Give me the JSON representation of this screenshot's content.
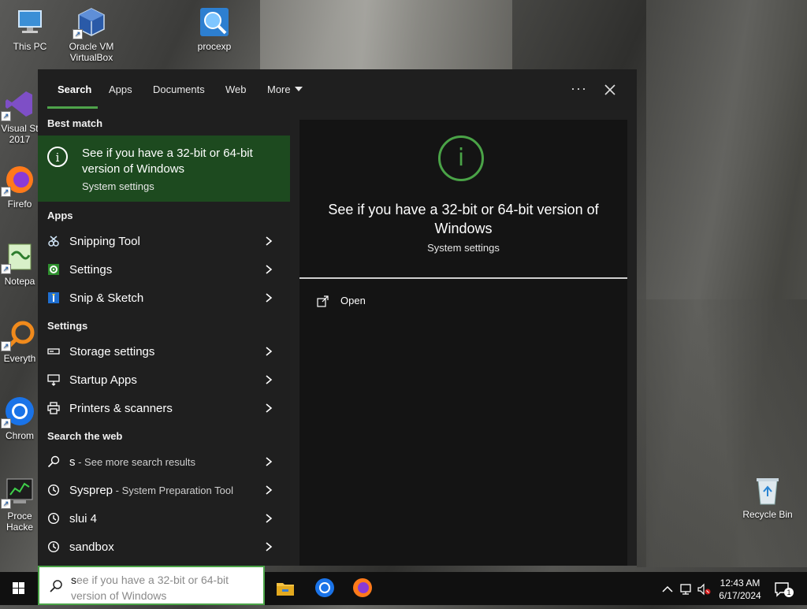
{
  "desktop": {
    "icons": [
      {
        "label": "This PC"
      },
      {
        "label": "Oracle VM VirtualBox"
      },
      {
        "label": "procexp"
      },
      {
        "label": "Visual St 2017"
      },
      {
        "label": "Firefo"
      },
      {
        "label": "Notepa"
      },
      {
        "label": "Everyth"
      },
      {
        "label": "Chrom"
      },
      {
        "label": "Proce Hacke"
      },
      {
        "label": "Recycle Bin"
      }
    ]
  },
  "search": {
    "tabs": [
      "Search",
      "Apps",
      "Documents",
      "Web",
      "More"
    ],
    "best_match": {
      "heading": "Best match",
      "title": "See if you have a 32-bit or 64-bit version of Windows",
      "subtitle": "System settings"
    },
    "apps_heading": "Apps",
    "apps": [
      {
        "label": "Snipping Tool",
        "icon": "snipping-tool-icon"
      },
      {
        "label": "Settings",
        "icon": "gear-icon"
      },
      {
        "label": "Snip & Sketch",
        "icon": "snip-sketch-icon"
      }
    ],
    "settings_heading": "Settings",
    "settings": [
      {
        "label": "Storage settings",
        "icon": "storage-icon"
      },
      {
        "label": "Startup Apps",
        "icon": "startup-icon"
      },
      {
        "label": "Printers & scanners",
        "icon": "printer-icon"
      }
    ],
    "web_heading": "Search the web",
    "web": [
      {
        "label": "s",
        "detail": " - See more search results",
        "icon": "search-icon"
      },
      {
        "label": "Sysprep",
        "detail": " - System Preparation Tool",
        "icon": "history-icon"
      },
      {
        "label": "slui 4",
        "detail": "",
        "icon": "history-icon"
      },
      {
        "label": "sandbox",
        "detail": "",
        "icon": "history-icon"
      }
    ],
    "preview": {
      "title": "See if you have a 32-bit or 64-bit version of Windows",
      "subtitle": "System settings",
      "open_label": "Open"
    },
    "input": {
      "value": "s",
      "placeholder": "ee if you have a 32-bit or 64-bit version of Windows"
    }
  },
  "taskbar": {
    "time": "12:43 AM",
    "date": "6/17/2024",
    "notification_count": "1"
  },
  "colors": {
    "accent": "#4aa347",
    "best_match_bg": "#1d4a1f",
    "panel_bg": "#202020"
  }
}
